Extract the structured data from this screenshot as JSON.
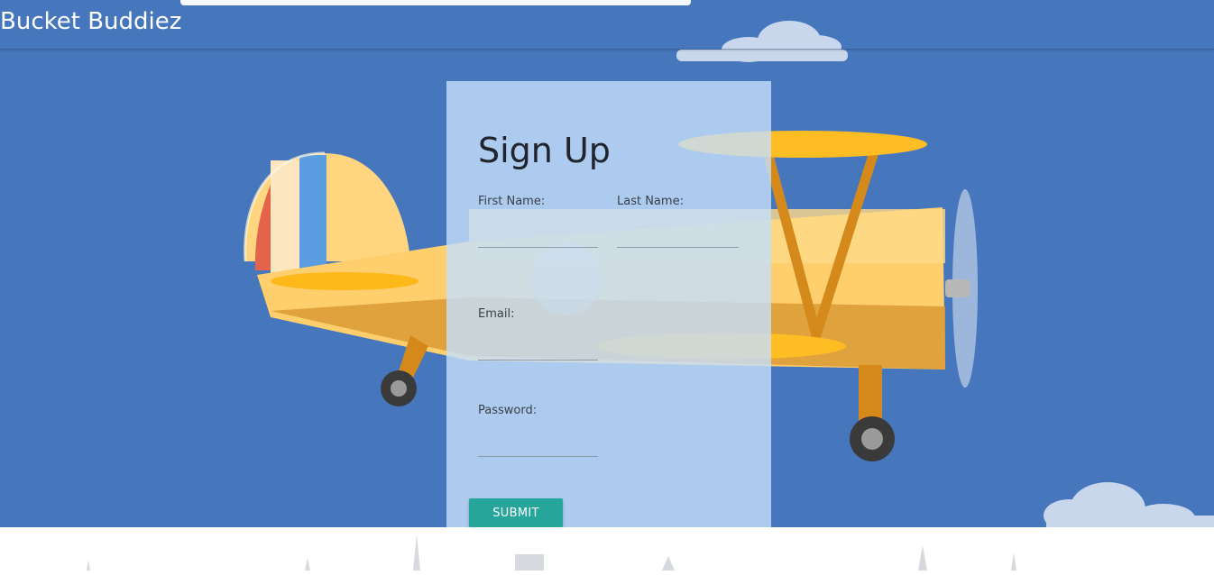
{
  "header": {
    "brand": "Bucket Buddiez"
  },
  "signup": {
    "title": "Sign Up",
    "first_name_label": "First Name:",
    "last_name_label": "Last Name:",
    "email_label": "Email:",
    "password_label": "Password:",
    "first_name_value": "",
    "last_name_value": "",
    "email_value": "",
    "password_value": "",
    "submit_label": "SUBMIT"
  },
  "colors": {
    "sky": "#4677bd",
    "card": "#c4defa",
    "submit": "#26a69a",
    "plane_yellow": "#ffb819",
    "plane_body": "#ffcf6e"
  },
  "icons": {
    "background": "biplane-illustration",
    "clouds": "cloud-shapes",
    "footer": "city-skyline-silhouette"
  }
}
